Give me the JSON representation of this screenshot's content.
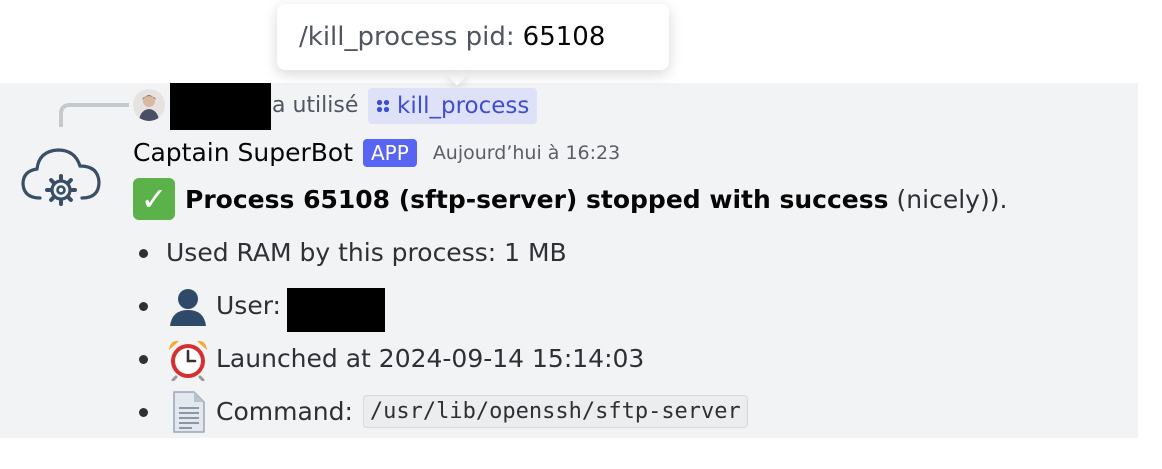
{
  "tooltip": {
    "command": "/kill_process pid:",
    "pid_value": "65108"
  },
  "reply": {
    "used_text": "a utilisé",
    "command_name": "kill_process"
  },
  "message": {
    "author": "Captain SuperBot",
    "badge": "APP",
    "timestamp": "Aujourd’hui à 16:23",
    "status_bold": "Process 65108 (sftp-server) stopped with success",
    "status_trail": "(nicely)).",
    "ram_line": "Used RAM by this process: 1 MB",
    "user_label": "User:",
    "launched_line": "Launched at 2024-09-14 15:14:03",
    "command_label": "Command:",
    "command_value": "/usr/lib/openssh/sftp-server"
  },
  "icons": {
    "check": "white-check-mark-icon",
    "user": "bust-silhouette-icon",
    "clock": "alarm-clock-icon",
    "doc": "page-facing-up-icon",
    "bot": "cloud-gear-icon",
    "command": "slash-command-icon"
  },
  "colors": {
    "accent": "#5865f2",
    "message_bg": "#f2f3f5",
    "pill_bg": "#dee1f8",
    "pill_text": "#3d4fcf",
    "check": "#5bb14a"
  }
}
